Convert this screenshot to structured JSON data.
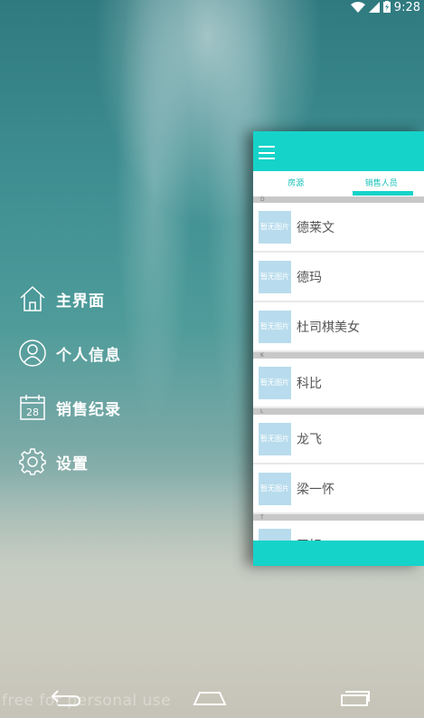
{
  "status_bar": {
    "time": "9:28"
  },
  "drawer": {
    "items": [
      {
        "label": "主界面",
        "icon": "home-icon"
      },
      {
        "label": "个人信息",
        "icon": "person-icon"
      },
      {
        "label": "销售纪录",
        "icon": "calendar-icon",
        "icon_text": "28"
      },
      {
        "label": "设置",
        "icon": "gear-icon"
      }
    ]
  },
  "panel": {
    "tabs": [
      {
        "label": "房源"
      },
      {
        "label": "销售人员"
      }
    ],
    "active_tab": 1,
    "thumb_placeholder": "暂无图片",
    "sections": [
      {
        "header": "D",
        "rows": [
          "德莱文",
          "德玛",
          "杜司棋美女"
        ]
      },
      {
        "header": "K",
        "rows": [
          "科比"
        ]
      },
      {
        "header": "L",
        "rows": [
          "龙飞",
          "梁一怀"
        ]
      },
      {
        "header": "T",
        "rows": [
          "天妃"
        ]
      }
    ]
  },
  "watermark": "free for personal use",
  "colors": {
    "accent": "#16d3c9",
    "thumb": "#b8dced",
    "section": "#c8c8c8"
  }
}
